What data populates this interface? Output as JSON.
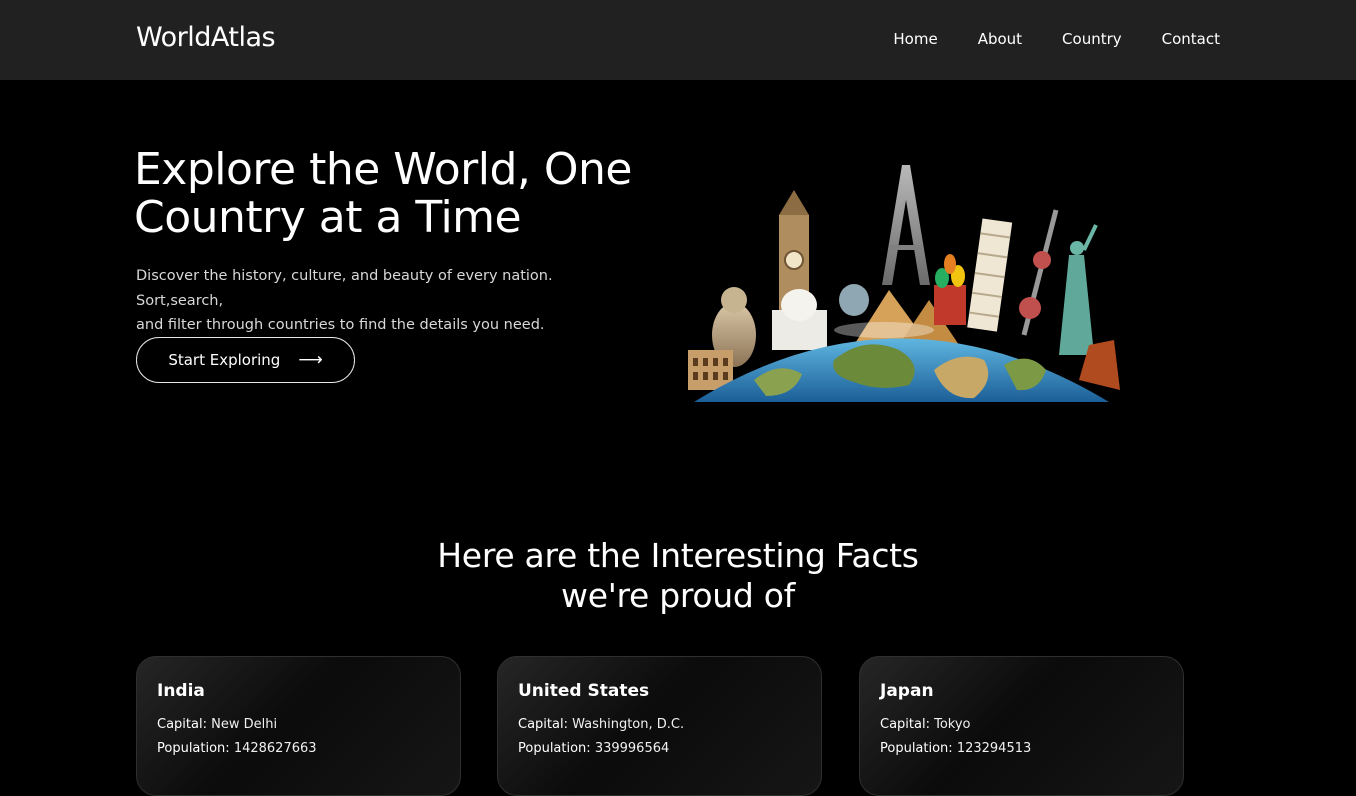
{
  "navbar": {
    "brand": "WorldAtlas",
    "links": [
      "Home",
      "About",
      "Country",
      "Contact"
    ]
  },
  "hero": {
    "title_line1": "Explore the World, One",
    "title_line2": "Country at a Time",
    "desc_line1": "Discover the history, culture, and beauty of every nation. Sort,search,",
    "desc_line2": "and filter through countries to find the details you need.",
    "cta_label": "Start Exploring",
    "cta_icon": "arrow-right-icon"
  },
  "facts": {
    "title_line1": "Here are the Interesting Facts",
    "title_line2": "we're proud of",
    "capital_label": "Capital:",
    "population_label": "Population:",
    "cards": [
      {
        "name": "India",
        "capital": "New Delhi",
        "population": "1428627663"
      },
      {
        "name": "United States",
        "capital": "Washington, D.C.",
        "population": "339996564"
      },
      {
        "name": "Japan",
        "capital": "Tokyo",
        "population": "123294513"
      }
    ]
  },
  "colors": {
    "navbar_bg": "#212121",
    "page_bg": "#000000",
    "text": "#ffffff"
  }
}
